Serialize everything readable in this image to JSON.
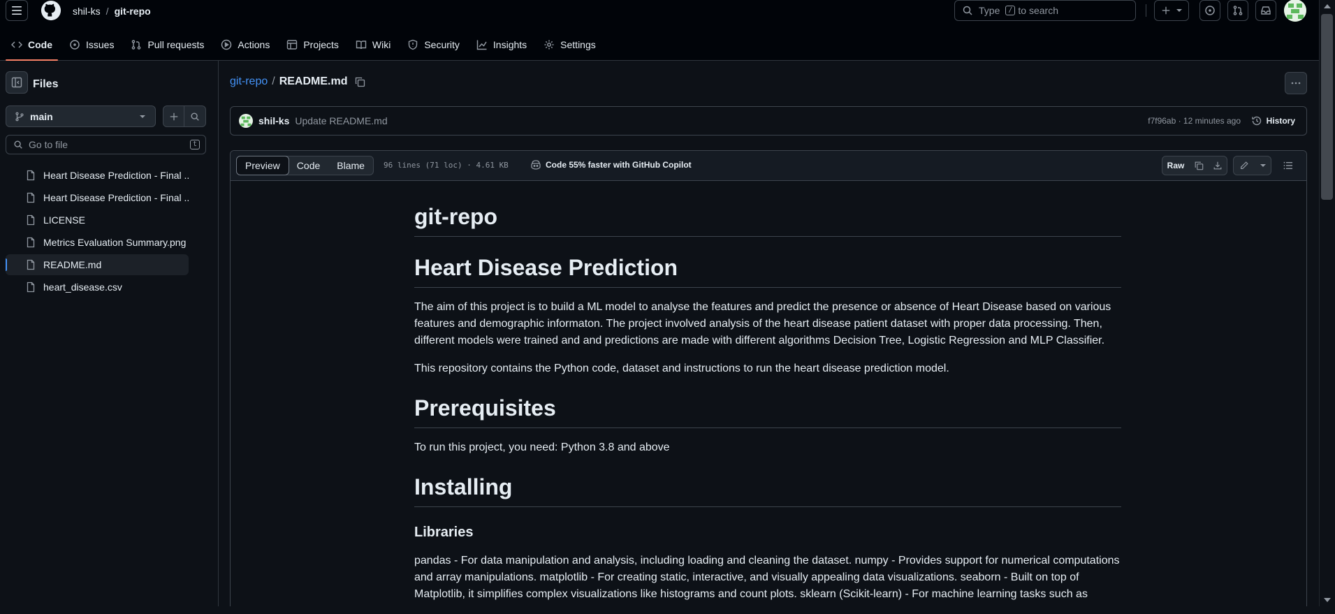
{
  "header": {
    "owner": "shil-ks",
    "repo": "git-repo",
    "search_prefix": "Type",
    "search_key": "/",
    "search_suffix": "to search"
  },
  "tabs": [
    {
      "label": "Code",
      "icon": "code-icon"
    },
    {
      "label": "Issues",
      "icon": "issue-opened-icon"
    },
    {
      "label": "Pull requests",
      "icon": "git-pull-request-icon"
    },
    {
      "label": "Actions",
      "icon": "play-icon"
    },
    {
      "label": "Projects",
      "icon": "table-icon"
    },
    {
      "label": "Wiki",
      "icon": "book-icon"
    },
    {
      "label": "Security",
      "icon": "shield-icon"
    },
    {
      "label": "Insights",
      "icon": "graph-icon"
    },
    {
      "label": "Settings",
      "icon": "gear-icon"
    }
  ],
  "sidebar": {
    "title": "Files",
    "branch": "main",
    "goto_placeholder": "Go to file",
    "goto_key": "t",
    "files": [
      {
        "name": "Heart Disease Prediction - Final ..."
      },
      {
        "name": "Heart Disease Prediction - Final ..."
      },
      {
        "name": "LICENSE"
      },
      {
        "name": "Metrics Evaluation Summary.png"
      },
      {
        "name": "README.md"
      },
      {
        "name": "heart_disease.csv"
      }
    ]
  },
  "breadcrumb": {
    "repo": "git-repo",
    "sep": "/",
    "file": "README.md"
  },
  "commit": {
    "author": "shil-ks",
    "message": "Update README.md",
    "hash_time": "f7f96ab · 12 minutes ago",
    "history": "History"
  },
  "fileview": {
    "tabs": [
      "Preview",
      "Code",
      "Blame"
    ],
    "meta": "96 lines (71 loc) · 4.61 KB",
    "copilot": "Code 55% faster with GitHub Copilot",
    "raw": "Raw"
  },
  "readme": {
    "h_title": "git-repo",
    "h_project": "Heart Disease Prediction",
    "p_aim": "The aim of this project is to build a ML model to analyse the features and predict the presence or absence of Heart Disease based on various features and demographic informaton. The project involved analysis of the heart disease patient dataset with proper data processing. Then, different models were trained and and predictions are made with different algorithms Decision Tree, Logistic Regression and MLP Classifier.",
    "p_repo": "This repository contains the Python code, dataset and instructions to run the heart disease prediction model.",
    "h_prereq": "Prerequisites",
    "p_prereq": "To run this project, you need: Python 3.8 and above",
    "h_install": "Installing",
    "h_libs": "Libraries",
    "p_libs": "pandas - For data manipulation and analysis, including loading and cleaning the dataset. numpy - Provides support for numerical computations and array manipulations. matplotlib - For creating static, interactive, and visually appealing data visualizations. seaborn - Built on top of Matplotlib, it simplifies complex visualizations like histograms and count plots. sklearn (Scikit-learn) - For machine learning tasks such as"
  },
  "colors": {
    "accent": "#4493f8",
    "tab_underline": "#f78166",
    "bg": "#0d1117"
  }
}
